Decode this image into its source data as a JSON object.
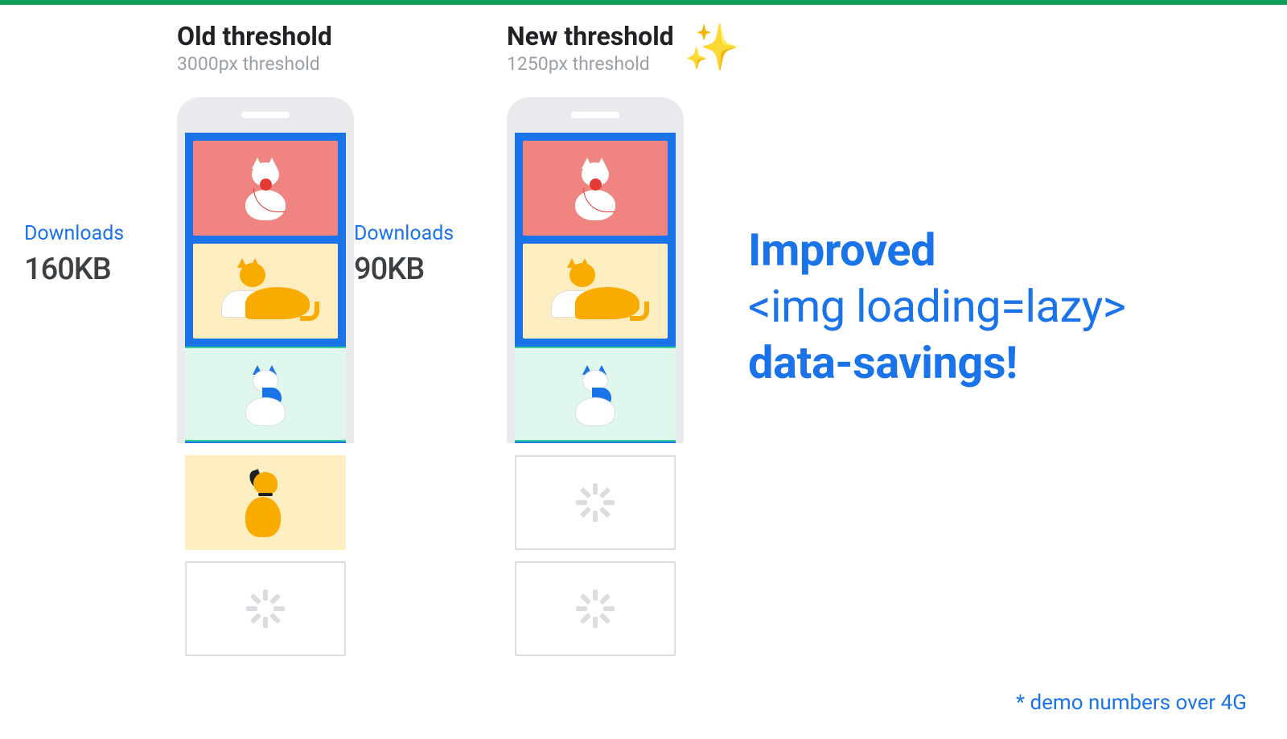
{
  "old": {
    "title": "Old threshold",
    "subtitle": "3000px threshold",
    "downloads_label": "Downloads",
    "downloads_value": "160KB"
  },
  "new": {
    "title": "New threshold",
    "subtitle": "1250px threshold",
    "downloads_label": "Downloads",
    "downloads_value": "90KB"
  },
  "headline": {
    "line1": "Improved",
    "line2": "<img loading=lazy>",
    "line3": "data-savings!"
  },
  "footnote": "* demo numbers over 4G",
  "sparkle": "✨"
}
